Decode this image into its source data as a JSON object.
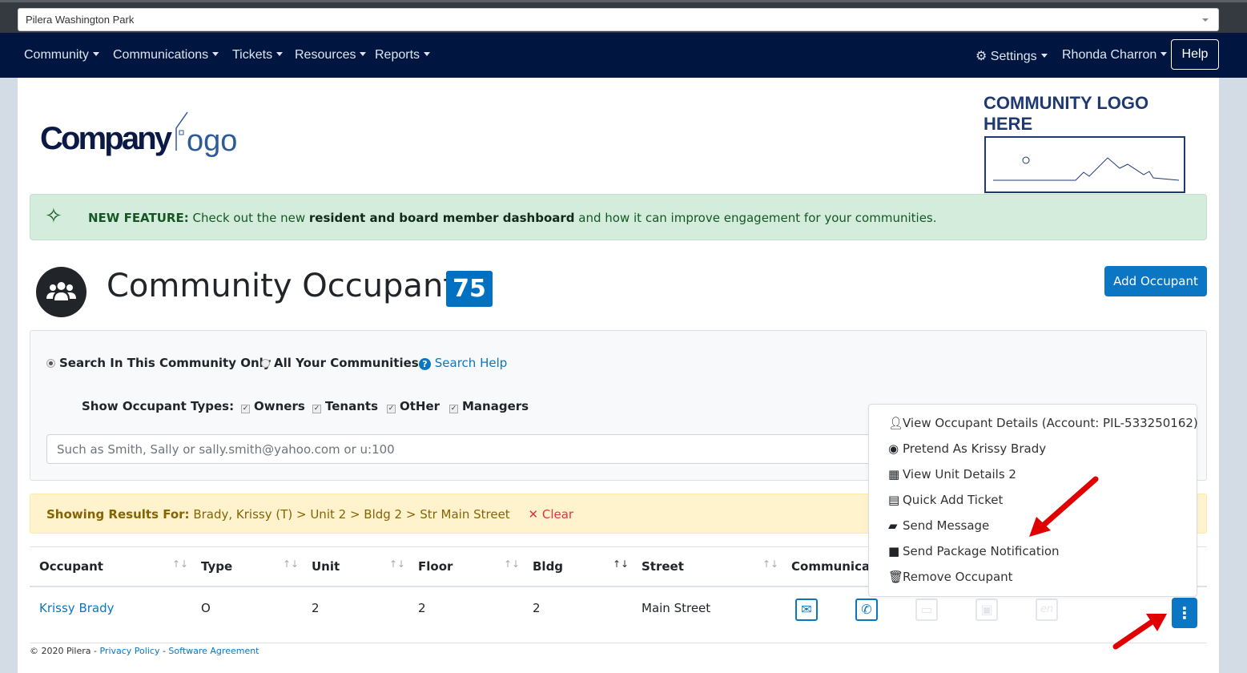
{
  "community_select": {
    "value": "Pilera Washington Park"
  },
  "nav": {
    "items": [
      "Community",
      "Communications",
      "Tickets",
      "Resources",
      "Reports"
    ],
    "settings": "Settings",
    "user": "Rhonda Charron",
    "help": "Help"
  },
  "logos": {
    "company": "CompanyLogo",
    "community": "COMMUNITY LOGO HERE"
  },
  "alert": {
    "label": "NEW FEATURE:",
    "text1": " Check out the new ",
    "bold": "resident and board member dashboard",
    "text2": " and how it can improve engagement for your communities."
  },
  "page": {
    "title": "Community Occupants",
    "count": "75",
    "add_button": "Add Occupant"
  },
  "search": {
    "scope_this": "Search In This Community Only",
    "scope_all": "All Your Communities",
    "help": "Search Help",
    "types_label": "Show Occupant Types:",
    "types": [
      "Owners",
      "Tenants",
      "OtHer",
      "Managers"
    ],
    "placeholder": "Such as Smith, Sally or sally.smith@yahoo.com or u:100"
  },
  "results": {
    "label": "Showing Results For:",
    "value": " Brady, Krissy (T) > Unit 2 > Bldg 2 > Str Main Street",
    "clear": "Clear"
  },
  "table": {
    "headers": [
      "Occupant",
      "Type",
      "Unit",
      "Floor",
      "Bldg",
      "Street",
      "Communicati"
    ],
    "row": {
      "occupant": "Krissy Brady",
      "type": "O",
      "unit": "2",
      "floor": "2",
      "bldg": "2",
      "street": "Main Street",
      "lang": "en"
    }
  },
  "menu": {
    "items": [
      "View Occupant Details (Account: PIL-533250162)",
      "Pretend As Krissy Brady",
      "View Unit Details 2",
      "Quick Add Ticket",
      "Send Message",
      "Send Package Notification",
      "Remove Occupant"
    ]
  },
  "footer": {
    "copy": "© 2020 Pilera - ",
    "privacy": "Privacy Policy",
    "sep": " - ",
    "agreement": "Software Agreement"
  },
  "colors": {
    "nav": "#001641",
    "primary": "#0a76c4",
    "alert_bg": "#d4ecdc",
    "results_bg": "#fff3cd",
    "arrow": "#e00000"
  }
}
